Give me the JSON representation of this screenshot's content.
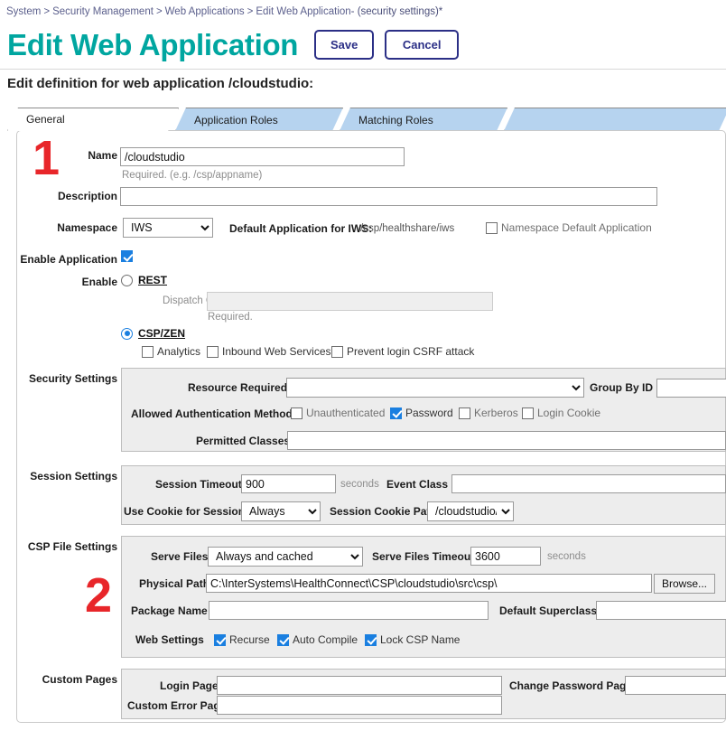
{
  "breadcrumb": {
    "items": [
      "System",
      "Security Management",
      "Web Applications",
      "Edit Web Application"
    ],
    "separator": ">",
    "tail": "-  (security settings)*"
  },
  "header": {
    "title": "Edit Web Application",
    "save_label": "Save",
    "cancel_label": "Cancel",
    "accent_color": "#00a6a0",
    "button_color": "#2b2f86"
  },
  "subtitle": "Edit definition for web application /cloudstudio:",
  "tabs": [
    {
      "label": "General",
      "active": true
    },
    {
      "label": "Application Roles",
      "active": false
    },
    {
      "label": "Matching Roles",
      "active": false
    }
  ],
  "markers": [
    {
      "text": "1"
    },
    {
      "text": "2"
    }
  ],
  "general": {
    "name_label": "Name",
    "name_value": "/cloudstudio",
    "name_hint": "Required. (e.g. /csp/appname)",
    "description_label": "Description",
    "description_value": "",
    "namespace_label": "Namespace",
    "namespace_value": "IWS",
    "namespace_options": [
      "IWS"
    ],
    "default_app_label": "Default Application for IWS:",
    "default_app_value": "/csp/healthshare/iws",
    "namespace_default_checkbox": "Namespace Default Application",
    "namespace_default_checked": false,
    "enable_application_label": "Enable Application",
    "enable_application_checked": true,
    "enable_label": "Enable",
    "rest_label": "REST",
    "rest_selected": false,
    "dispatch_class_label": "Dispatch Class",
    "dispatch_class_value": "",
    "dispatch_class_hint": "Required.",
    "cspzen_label": "CSP/ZEN",
    "cspzen_selected": true,
    "analytics_label": "Analytics",
    "analytics_checked": false,
    "inbound_web_services_label": "Inbound Web Services",
    "inbound_web_services_checked": false,
    "prevent_csrf_label": "Prevent login CSRF attack",
    "prevent_csrf_checked": false
  },
  "security_settings": {
    "section_label": "Security Settings",
    "resource_required_label": "Resource Required",
    "resource_required_value": "",
    "group_by_id_label": "Group By ID",
    "group_by_id_value": "",
    "allowed_auth_label": "Allowed Authentication Methods",
    "auth_methods": [
      {
        "label": "Unauthenticated",
        "checked": false
      },
      {
        "label": "Password",
        "checked": true
      },
      {
        "label": "Kerberos",
        "checked": false
      },
      {
        "label": "Login Cookie",
        "checked": false
      }
    ],
    "permitted_classes_label": "Permitted Classes",
    "permitted_classes_value": ""
  },
  "session_settings": {
    "section_label": "Session Settings",
    "session_timeout_label": "Session Timeout",
    "session_timeout_value": "900",
    "seconds_label": "seconds",
    "event_class_label": "Event Class",
    "event_class_value": "",
    "use_cookie_label": "Use Cookie for Session",
    "use_cookie_value": "Always",
    "use_cookie_options": [
      "Always"
    ],
    "session_cookie_path_label": "Session Cookie Path",
    "session_cookie_path_value": "/cloudstudio/",
    "session_cookie_path_options": [
      "/cloudstudio/"
    ]
  },
  "csp_file_settings": {
    "section_label": "CSP File Settings",
    "serve_files_label": "Serve Files",
    "serve_files_value": "Always and cached",
    "serve_files_options": [
      "Always and cached"
    ],
    "serve_files_timeout_label": "Serve Files Timeout",
    "serve_files_timeout_value": "3600",
    "seconds_label": "seconds",
    "physical_path_label": "Physical Path",
    "physical_path_value": "C:\\InterSystems\\HealthConnect\\CSP\\cloudstudio\\src\\csp\\",
    "browse_label": "Browse...",
    "package_name_label": "Package Name",
    "package_name_value": "",
    "default_superclass_label": "Default Superclass",
    "default_superclass_value": "",
    "web_settings_label": "Web Settings",
    "web_settings": [
      {
        "label": "Recurse",
        "checked": true
      },
      {
        "label": "Auto Compile",
        "checked": true
      },
      {
        "label": "Lock CSP Name",
        "checked": true
      }
    ]
  },
  "custom_pages": {
    "section_label": "Custom Pages",
    "login_page_label": "Login Page",
    "login_page_value": "",
    "change_password_page_label": "Change Password Page",
    "change_password_page_value": "",
    "custom_error_page_label": "Custom Error Page",
    "custom_error_page_value": ""
  }
}
